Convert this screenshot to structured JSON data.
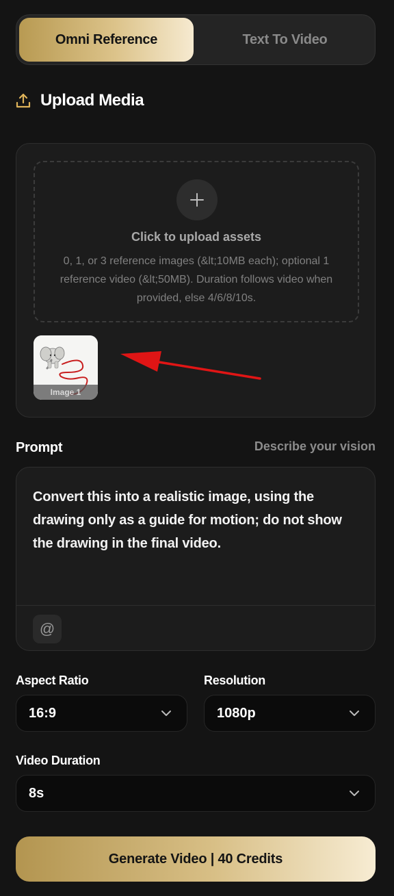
{
  "tabs": [
    {
      "label": "Omni Reference",
      "active": true
    },
    {
      "label": "Text To Video",
      "active": false
    }
  ],
  "upload": {
    "heading": "Upload Media",
    "icon": "upload-icon",
    "dropzone_title": "Click to upload assets",
    "dropzone_description": "0, 1, or 3 reference images (&lt;10MB each); optional 1 reference video (&lt;50MB). Duration follows video when provided, else 4/6/8/10s.",
    "thumbnails": [
      {
        "caption": "Image 1"
      }
    ]
  },
  "prompt": {
    "label": "Prompt",
    "hint": "Describe your vision",
    "text": "Convert this into a realistic image, using the drawing only as a guide for motion; do not show the drawing in the final video.",
    "mention_symbol": "@"
  },
  "aspect_ratio": {
    "label": "Aspect Ratio",
    "value": "16:9"
  },
  "resolution": {
    "label": "Resolution",
    "value": "1080p"
  },
  "video_duration": {
    "label": "Video Duration",
    "value": "8s"
  },
  "generate_button": {
    "label": "Generate Video | 40 Credits"
  },
  "colors": {
    "background": "#141414",
    "panel": "#1c1c1c",
    "accent_gold_start": "#b89a52",
    "accent_gold_end": "#f6ead0",
    "annotation_arrow": "#e01515"
  }
}
